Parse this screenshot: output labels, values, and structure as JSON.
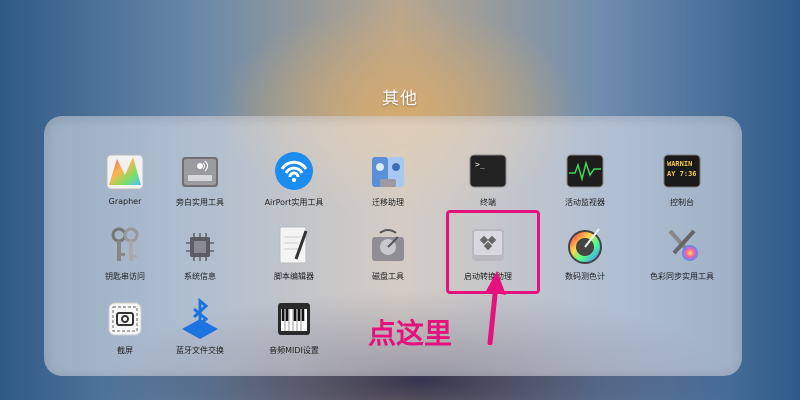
{
  "folder": {
    "title": "其他"
  },
  "apps": [
    {
      "label": "Grapher",
      "icon": "grapher-icon"
    },
    {
      "label": "旁白实用工具",
      "icon": "voiceover-utility-icon"
    },
    {
      "label": "AirPort实用工具",
      "icon": "airport-utility-icon"
    },
    {
      "label": "迁移助理",
      "icon": "migration-assistant-icon"
    },
    {
      "label": "终端",
      "icon": "terminal-icon"
    },
    {
      "label": "活动监视器",
      "icon": "activity-monitor-icon"
    },
    {
      "label": "控制台",
      "icon": "console-icon"
    },
    {
      "label": "钥匙串访问",
      "icon": "keychain-access-icon"
    },
    {
      "label": "系统信息",
      "icon": "system-information-icon"
    },
    {
      "label": "脚本编辑器",
      "icon": "script-editor-icon"
    },
    {
      "label": "磁盘工具",
      "icon": "disk-utility-icon"
    },
    {
      "label": "启动转换助理",
      "icon": "boot-camp-assistant-icon"
    },
    {
      "label": "数码测色计",
      "icon": "digital-color-meter-icon"
    },
    {
      "label": "色彩同步实用工具",
      "icon": "colorsync-utility-icon"
    },
    {
      "label": "截屏",
      "icon": "screenshot-icon"
    },
    {
      "label": "蓝牙文件交换",
      "icon": "bluetooth-file-exchange-icon"
    },
    {
      "label": "音频MIDI设置",
      "icon": "audio-midi-setup-icon"
    }
  ],
  "icon_texts": {
    "terminal_prompt": ">_",
    "console_text": "WARNIN\nAY 7:36"
  },
  "annotation": {
    "text": "点这里"
  },
  "colors": {
    "annotation": "#e5127d"
  }
}
